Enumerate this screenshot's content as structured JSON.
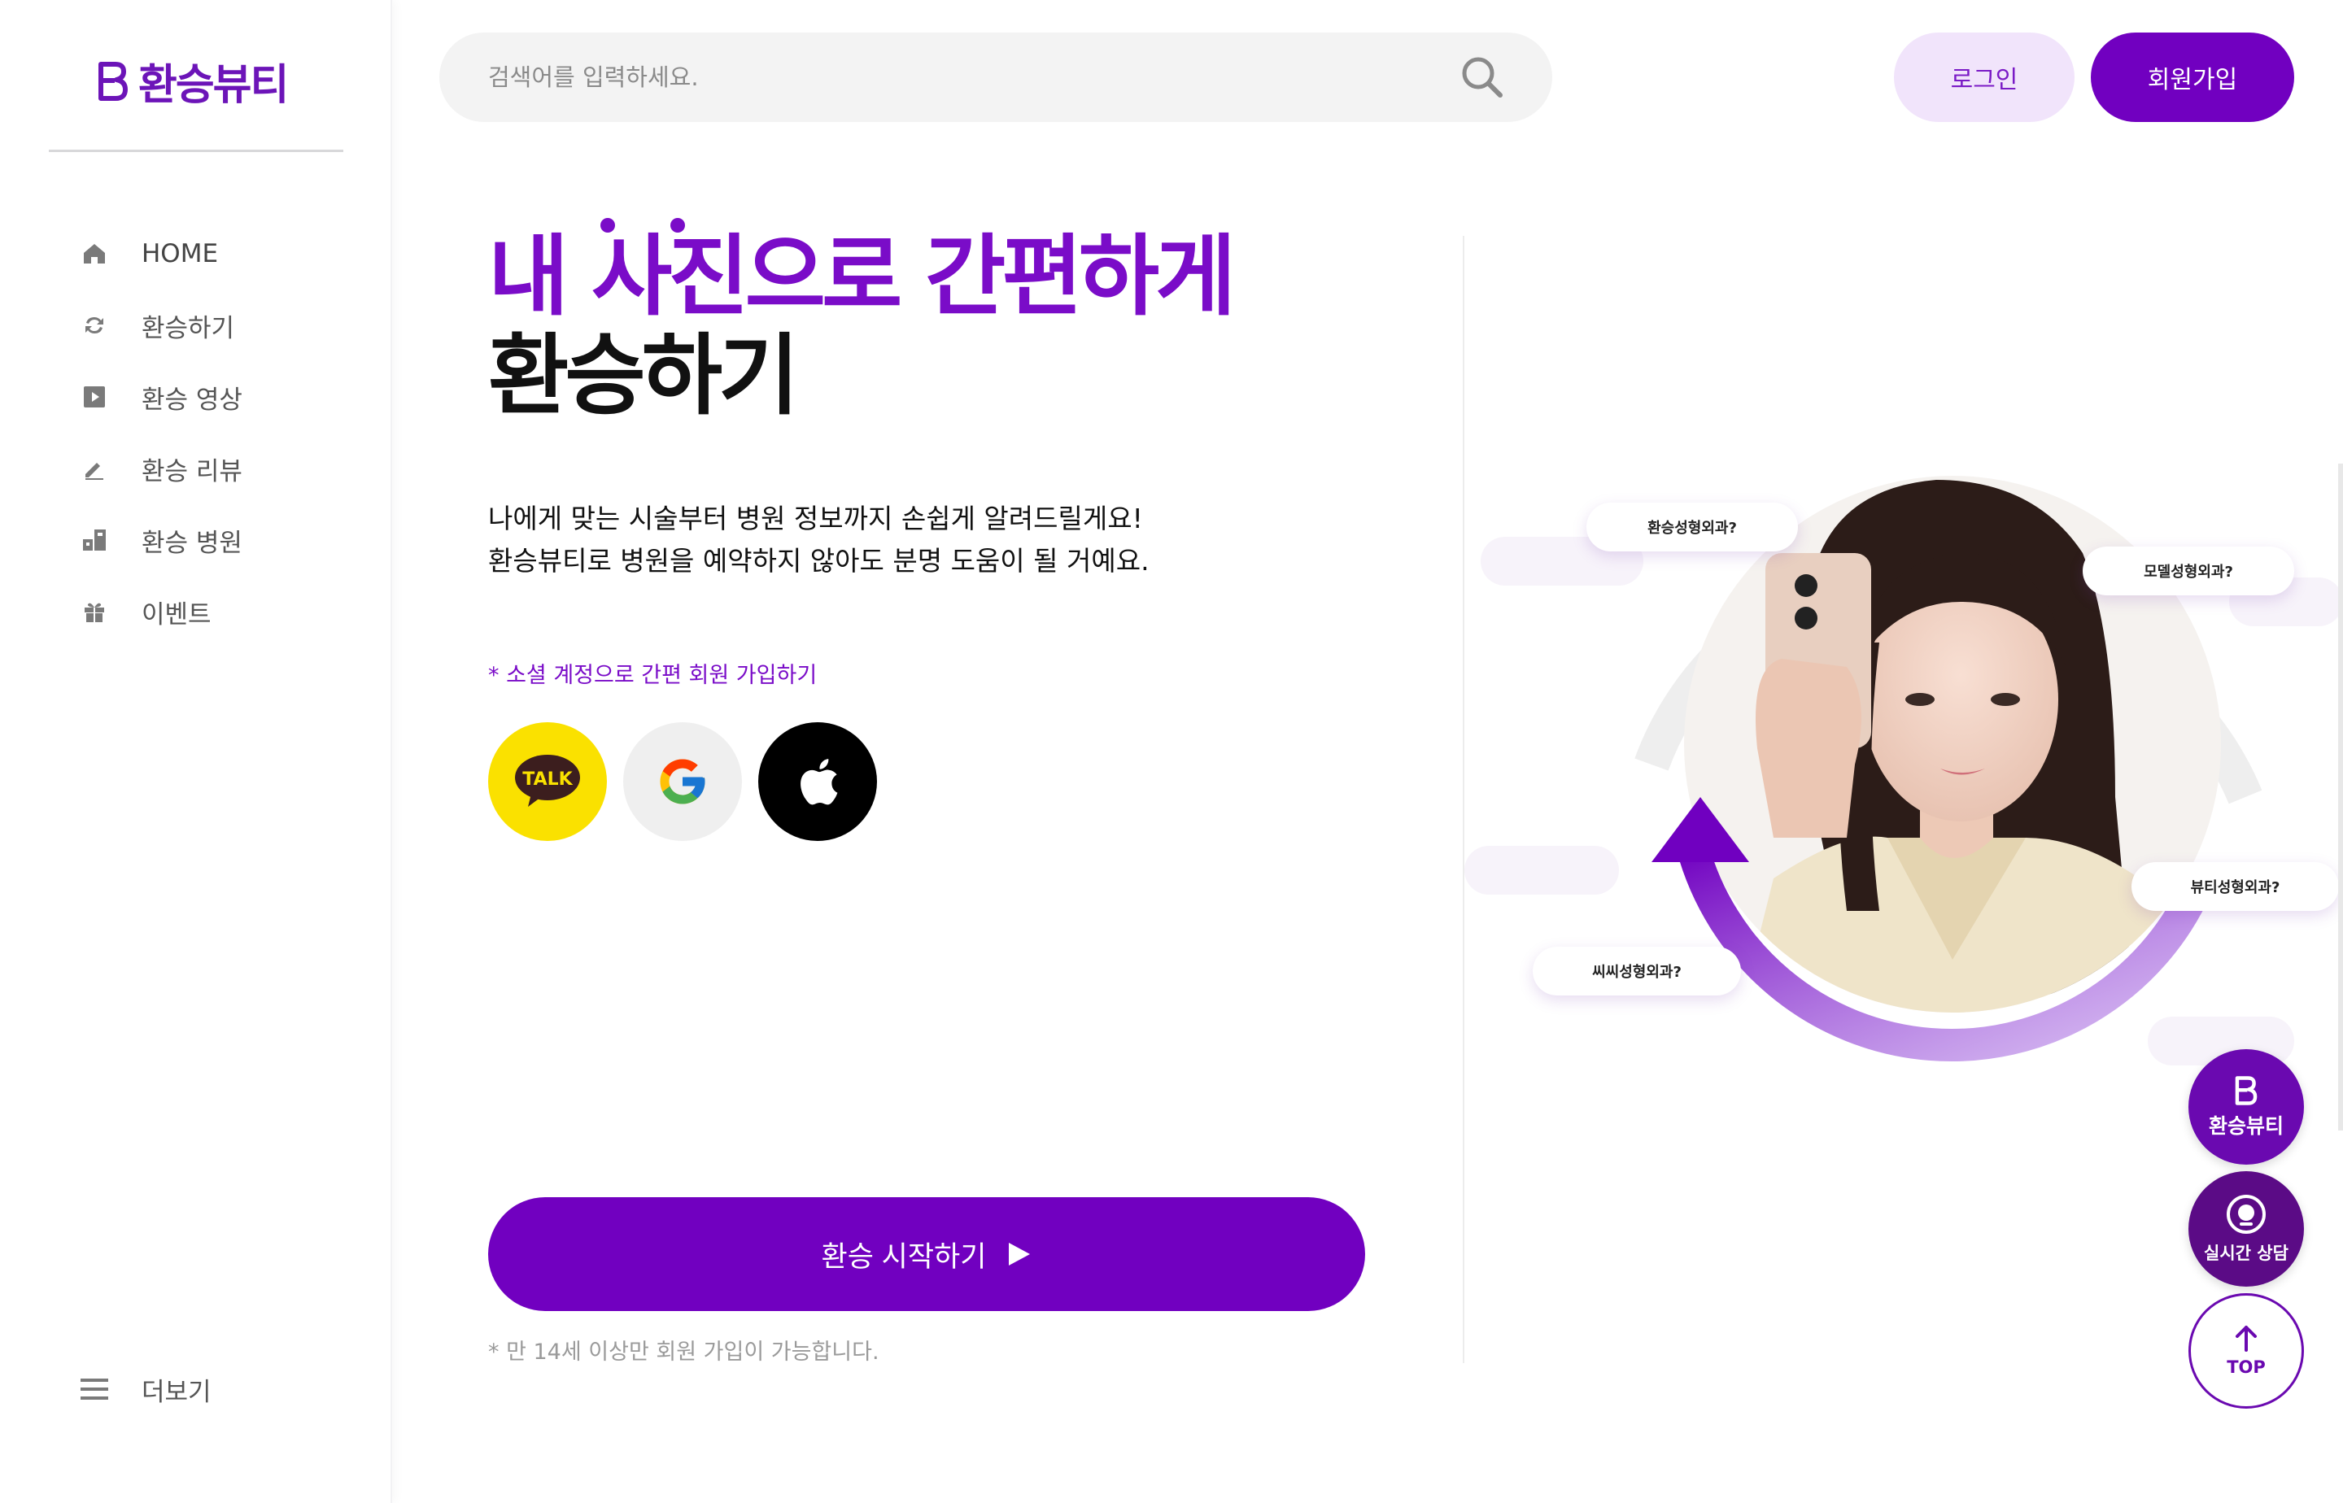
{
  "brand": {
    "name": "환승뷰티",
    "color": "#6c14b8"
  },
  "sidebar": {
    "items": [
      {
        "label": "HOME",
        "icon": "home-icon"
      },
      {
        "label": "환승하기",
        "icon": "transfer-icon"
      },
      {
        "label": "환승 영상",
        "icon": "video-icon"
      },
      {
        "label": "환승 리뷰",
        "icon": "pen-icon"
      },
      {
        "label": "환승 병원",
        "icon": "hospital-icon"
      },
      {
        "label": "이벤트",
        "icon": "gift-icon"
      }
    ],
    "more_label": "더보기"
  },
  "search": {
    "placeholder": "검색어를 입력하세요.",
    "value": ""
  },
  "header": {
    "login_label": "로그인",
    "signup_label": "회원가입"
  },
  "hero": {
    "title_line1": "내 사진으로 간편하게",
    "title_line2": "환승하기",
    "desc_line1": "나에게 맞는 시술부터 병원 정보까지 손쉽게 알려드릴게요!",
    "desc_line2": "환승뷰티로 병원을 예약하지 않아도 분명 도움이 될 거예요.",
    "social_caption": "* 소셜 계정으로 간편 회원 가입하기",
    "social": [
      {
        "name": "kakao",
        "label": "TALK"
      },
      {
        "name": "google",
        "label": ""
      },
      {
        "name": "apple",
        "label": ""
      }
    ],
    "start_label": "환승 시작하기",
    "age_note": "* 만 14세 이상만 회원 가입이 가능합니다."
  },
  "illustration": {
    "bubbles": [
      "환승성형외과?",
      "모델성형외과?",
      "뷰티성형외과?",
      "씨씨성형외과?"
    ]
  },
  "floating": {
    "brand_label": "환승뷰티",
    "chat_label": "실시간 상담",
    "top_label": "TOP"
  },
  "colors": {
    "accent": "#7100c0",
    "accent_light": "#f1e4fb",
    "kakao": "#fae100"
  }
}
